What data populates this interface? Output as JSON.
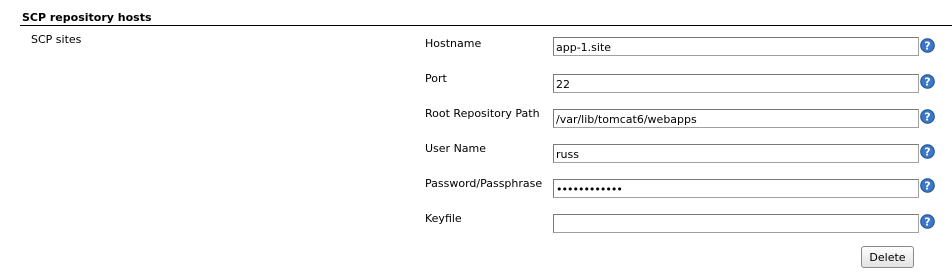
{
  "section": {
    "title": "SCP repository hosts",
    "sub_label": "SCP sites"
  },
  "fields": {
    "hostname": {
      "label": "Hostname",
      "value": "app-1.site"
    },
    "port": {
      "label": "Port",
      "value": "22"
    },
    "root_path": {
      "label": "Root Repository Path",
      "value": "/var/lib/tomcat6/webapps"
    },
    "username": {
      "label": "User Name",
      "value": "russ"
    },
    "password": {
      "label": "Password/Passphrase",
      "value": "••••••••••••"
    },
    "keyfile": {
      "label": "Keyfile",
      "value": ""
    }
  },
  "actions": {
    "delete_label": "Delete"
  },
  "icons": {
    "help": "help-icon"
  },
  "colors": {
    "help_icon_fill": "#3a78c7",
    "rule": "#000000"
  }
}
